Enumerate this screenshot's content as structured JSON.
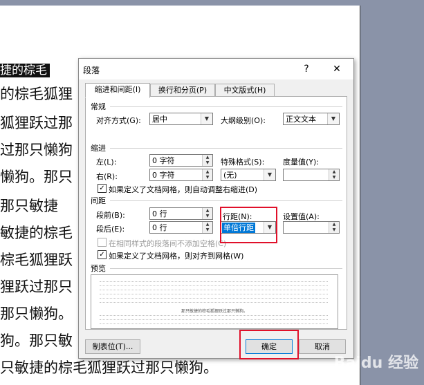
{
  "document": {
    "lines": [
      "捷的棕毛",
      "的棕毛狐狸",
      "狐狸跃过那",
      "过那只懒狗",
      "懒狗。那只",
      "那只敏捷",
      "敏捷的棕毛",
      "棕毛狐狸跃",
      "狸跃过那只",
      "那只懒狗。",
      "狗。那只敏",
      "只敏捷的棕毛狐狸跃过那只懒狗。"
    ]
  },
  "dialog": {
    "title": "段落",
    "help": "?",
    "close": "✕",
    "tabs": [
      "缩进和间距(I)",
      "换行和分页(P)",
      "中文版式(H)"
    ],
    "general": {
      "section": "常规",
      "alignment_label": "对齐方式(G):",
      "alignment_value": "居中",
      "outline_label": "大纲级别(O):",
      "outline_value": "正文文本"
    },
    "indent": {
      "section": "缩进",
      "left_label": "左(L):",
      "left_value": "0 字符",
      "right_label": "右(R):",
      "right_value": "0 字符",
      "special_label": "特殊格式(S):",
      "special_value": "(无)",
      "measure_label": "度量值(Y):",
      "measure_value": "",
      "auto_adjust": "如果定义了文档网格，则自动调整右缩进(D)"
    },
    "spacing": {
      "section": "间距",
      "before_label": "段前(B):",
      "before_value": "0 行",
      "after_label": "段后(E):",
      "after_value": "0 行",
      "line_label": "行距(N):",
      "line_value": "单倍行距",
      "setting_label": "设置值(A):",
      "setting_value": "",
      "no_space_same_style": "在相同样式的段落间不添加空格(C)",
      "snap_grid": "如果定义了文档网格，则对齐到网格(W)"
    },
    "preview": {
      "section": "预览",
      "sample_text": "那只敏捷的棕毛狐狸跃过那只懒狗。"
    },
    "buttons": {
      "tabs": "制表位(T)...",
      "ok": "确定",
      "cancel": "取消"
    }
  },
  "watermark": "Baidu 经验"
}
